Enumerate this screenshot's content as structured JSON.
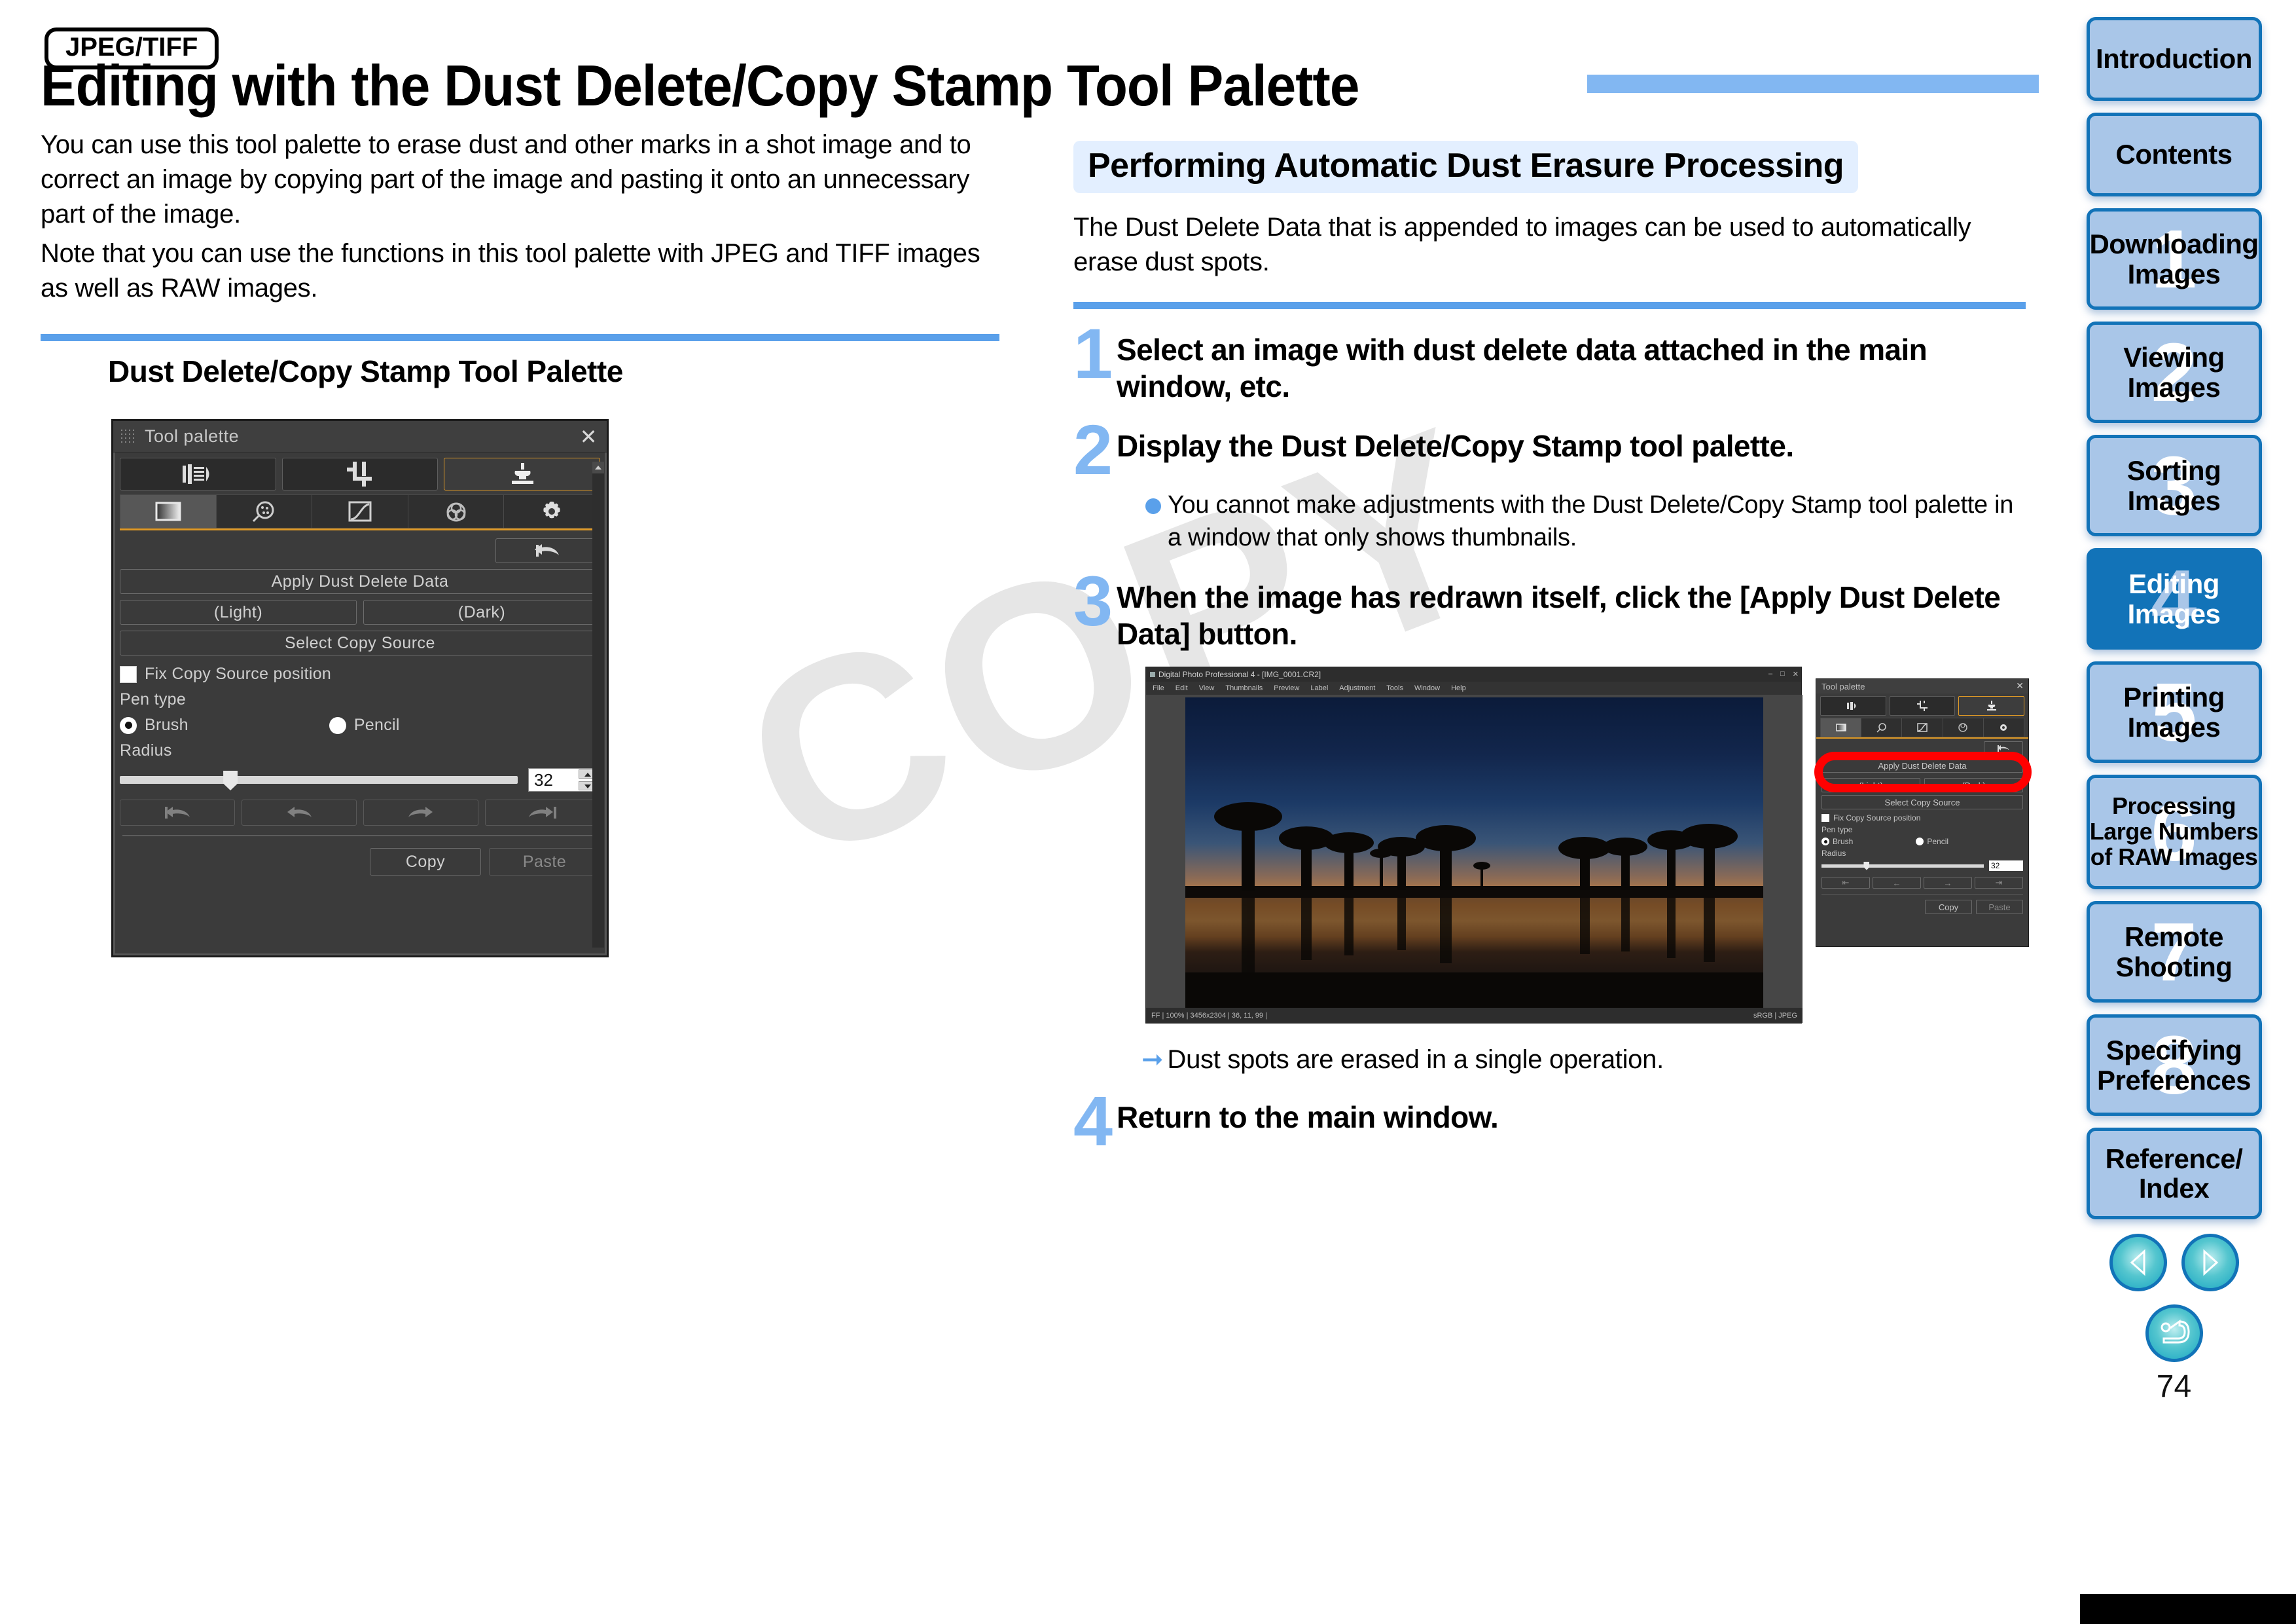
{
  "header": {
    "badge": "JPEG/TIFF",
    "title": "Editing with the Dust Delete/Copy Stamp Tool Palette"
  },
  "left": {
    "intro_p1": "You can use this tool palette to erase dust and other marks in a shot image and to correct an image by copying part of the image and pasting it onto an unnecessary part of the image.",
    "intro_p2": "Note that you can use the functions in this tool palette with JPEG and TIFF images as well as RAW images.",
    "subheading": "Dust Delete/Copy Stamp Tool Palette"
  },
  "palette": {
    "window_title": "Tool palette",
    "close_label": "✕",
    "tabs_row1": [
      {
        "name": "lens-correction-tool",
        "icon": "lens-icon"
      },
      {
        "name": "crop-angle-tool",
        "icon": "crop-icon"
      },
      {
        "name": "dust-delete-copy-stamp-tool",
        "icon": "stamp-icon",
        "selected": true
      }
    ],
    "tabs_row2": [
      {
        "name": "basic-adjustment-tab",
        "icon": "gradient-square-icon",
        "selected": true
      },
      {
        "name": "detail-adjustment-tab",
        "icon": "magnifier-dust-icon"
      },
      {
        "name": "tone-curve-tab",
        "icon": "tone-curve-icon"
      },
      {
        "name": "color-adjustment-tab",
        "icon": "color-wheel-icon"
      },
      {
        "name": "settings-tab",
        "icon": "gear-icon"
      }
    ],
    "reset_button": "⇤",
    "apply_dust_delete_data": "Apply Dust Delete Data",
    "light_button": "(Light)",
    "dark_button": "(Dark)",
    "select_copy_source": "Select Copy Source",
    "fix_copy_source_position": "Fix Copy Source position",
    "fix_copy_source_checked": false,
    "pen_type_label": "Pen type",
    "pen_brush": "Brush",
    "pen_pencil": "Pencil",
    "pen_selected": "Brush",
    "radius_label": "Radius",
    "radius_value": "32",
    "copy_button": "Copy",
    "paste_button": "Paste",
    "history_buttons": [
      "revert-to-start",
      "undo",
      "redo",
      "forward-to-end"
    ]
  },
  "right": {
    "section_heading": "Performing Automatic Dust Erasure Processing",
    "section_desc": "The Dust Delete Data that is appended to images can be used to automatically erase dust spots.",
    "steps": [
      {
        "num": "1",
        "text": "Select an image with dust delete data attached in the main window, etc."
      },
      {
        "num": "2",
        "text": "Display the Dust Delete/Copy Stamp tool palette."
      },
      {
        "num": "3",
        "text": "When the image has redrawn itself, click the [Apply Dust Delete Data] button."
      },
      {
        "num": "4",
        "text": "Return to the main window."
      }
    ],
    "bullet_step2": "You cannot make adjustments with the Dust Delete/Copy Stamp tool palette in a window that only shows thumbnails.",
    "result_step3": "Dust spots are erased in a single operation."
  },
  "screenshot": {
    "app_title": "Digital Photo Professional 4 - [IMG_0001.CR2]",
    "menus": [
      "File",
      "Edit",
      "View",
      "Thumbnails",
      "Preview",
      "Label",
      "Adjustment",
      "Tools",
      "Window",
      "Help"
    ],
    "status_left": "FF | 100% | 3456x2304 | 36, 11, 99 |",
    "status_right": "sRGB | JPEG",
    "mini_palette": {
      "title": "Tool palette",
      "close": "✕",
      "apply_dust_delete_data": "Apply Dust Delete Data",
      "light": "(Light)",
      "dark": "(Dark)",
      "select_copy_source": "Select Copy Source",
      "fix_copy_source_position": "Fix Copy Source position",
      "pen_type": "Pen type",
      "brush": "Brush",
      "pencil": "Pencil",
      "radius": "Radius",
      "radius_value": "32",
      "copy": "Copy",
      "paste": "Paste",
      "highlight_color": "#ff0000"
    }
  },
  "sidebar": {
    "tabs": [
      {
        "label": "Introduction",
        "num": "",
        "active": false,
        "small": false
      },
      {
        "label": "Contents",
        "num": "",
        "active": false,
        "small": false
      },
      {
        "label": "Downloading\nImages",
        "num": "1",
        "active": false,
        "small": false
      },
      {
        "label": "Viewing\nImages",
        "num": "2",
        "active": false,
        "small": false
      },
      {
        "label": "Sorting\nImages",
        "num": "3",
        "active": false,
        "small": false
      },
      {
        "label": "Editing\nImages",
        "num": "4",
        "active": true,
        "small": false
      },
      {
        "label": "Printing\nImages",
        "num": "5",
        "active": false,
        "small": false
      },
      {
        "label": "Processing\nLarge Numbers\nof RAW Images",
        "num": "6",
        "active": false,
        "small": true
      },
      {
        "label": "Remote\nShooting",
        "num": "7",
        "active": false,
        "small": false
      },
      {
        "label": "Specifying\nPreferences",
        "num": "8",
        "active": false,
        "small": false
      },
      {
        "label": "Reference/\nIndex",
        "num": "",
        "active": false,
        "small": false
      }
    ],
    "prev_label": "previous-page",
    "next_label": "next-page",
    "home_label": "return-to-top",
    "page_number": "74"
  },
  "watermark": "COPY",
  "colors": {
    "accent_blue": "#5aa0ea",
    "light_blue": "#82b7f2",
    "tab_blue": "#a9c6e8",
    "tab_border": "#1273b8",
    "section_bg": "#e3efff",
    "highlight_orange": "#e09a26",
    "alert_red": "#ff0000"
  }
}
